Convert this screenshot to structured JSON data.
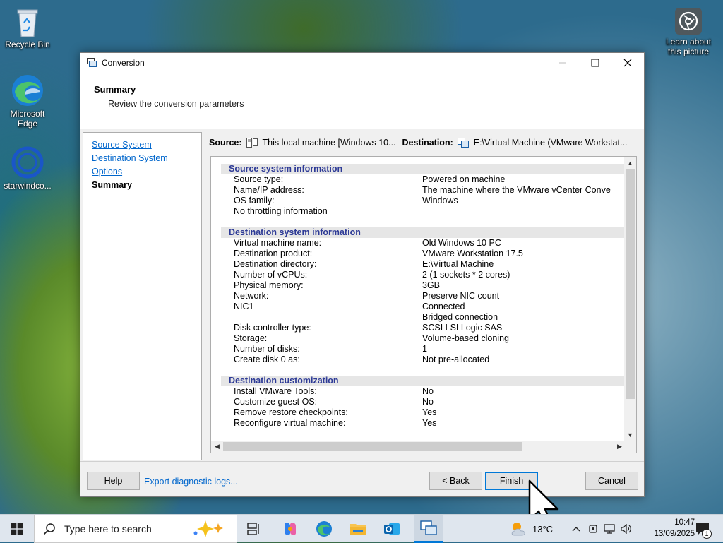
{
  "desktop": {
    "icons": [
      {
        "label": "Recycle Bin",
        "icon": "recycle-bin-icon"
      },
      {
        "label": "Microsoft Edge",
        "icon": "edge-icon"
      },
      {
        "label": "starwindco...",
        "icon": "starwind-icon"
      }
    ],
    "spotlight": {
      "label": "Learn about this picture",
      "icon": "camera-icon"
    }
  },
  "window": {
    "title": "Conversion",
    "header": {
      "title": "Summary",
      "subtitle": "Review the conversion parameters"
    },
    "nav": [
      "Source System",
      "Destination System",
      "Options",
      "Summary"
    ],
    "source_label": "Source:",
    "source_value": "This local machine [Windows 10...",
    "destination_label": "Destination:",
    "destination_value": "E:\\Virtual Machine (VMware Workstat...",
    "sections": [
      {
        "title": "Source system information",
        "rows": [
          {
            "k": "Source type:",
            "v": "Powered on machine"
          },
          {
            "k": "Name/IP address:",
            "v": "The machine where the VMware vCenter Conve"
          },
          {
            "k": "OS family:",
            "v": "Windows"
          },
          {
            "k": "No throttling information",
            "v": ""
          }
        ]
      },
      {
        "title": "Destination system information",
        "rows": [
          {
            "k": "Virtual machine name:",
            "v": "Old Windows 10 PC"
          },
          {
            "k": "Destination product:",
            "v": "VMware Workstation 17.5"
          },
          {
            "k": "Destination directory:",
            "v": "E:\\Virtual Machine"
          },
          {
            "k": "Number of vCPUs:",
            "v": "2 (1 sockets * 2 cores)"
          },
          {
            "k": "Physical memory:",
            "v": "3GB"
          },
          {
            "k": "Network:",
            "v": "Preserve NIC count"
          },
          {
            "k": "NIC1",
            "v": "Connected"
          },
          {
            "k": "",
            "v": "Bridged connection"
          },
          {
            "k": "Disk controller type:",
            "v": "SCSI LSI Logic SAS"
          },
          {
            "k": "Storage:",
            "v": "Volume-based cloning"
          },
          {
            "k": "Number of disks:",
            "v": "1"
          },
          {
            "k": "Create disk 0 as:",
            "v": "Not pre-allocated"
          }
        ]
      },
      {
        "title": "Destination customization",
        "rows": [
          {
            "k": "Install VMware Tools:",
            "v": "No"
          },
          {
            "k": "Customize guest OS:",
            "v": "No"
          },
          {
            "k": "Remove restore checkpoints:",
            "v": "Yes"
          },
          {
            "k": "Reconfigure virtual machine:",
            "v": "Yes"
          }
        ]
      }
    ],
    "buttons": {
      "help": "Help",
      "export": "Export diagnostic logs...",
      "back": "< Back",
      "finish": "Finish",
      "cancel": "Cancel"
    }
  },
  "taskbar": {
    "search_placeholder": "Type here to search",
    "weather": "13°C",
    "time": "10:47",
    "date": "13/09/2025",
    "notifications": "1"
  },
  "colors": {
    "link": "#0066cc",
    "section_title": "#2d3a96",
    "accent": "#0078d7"
  }
}
